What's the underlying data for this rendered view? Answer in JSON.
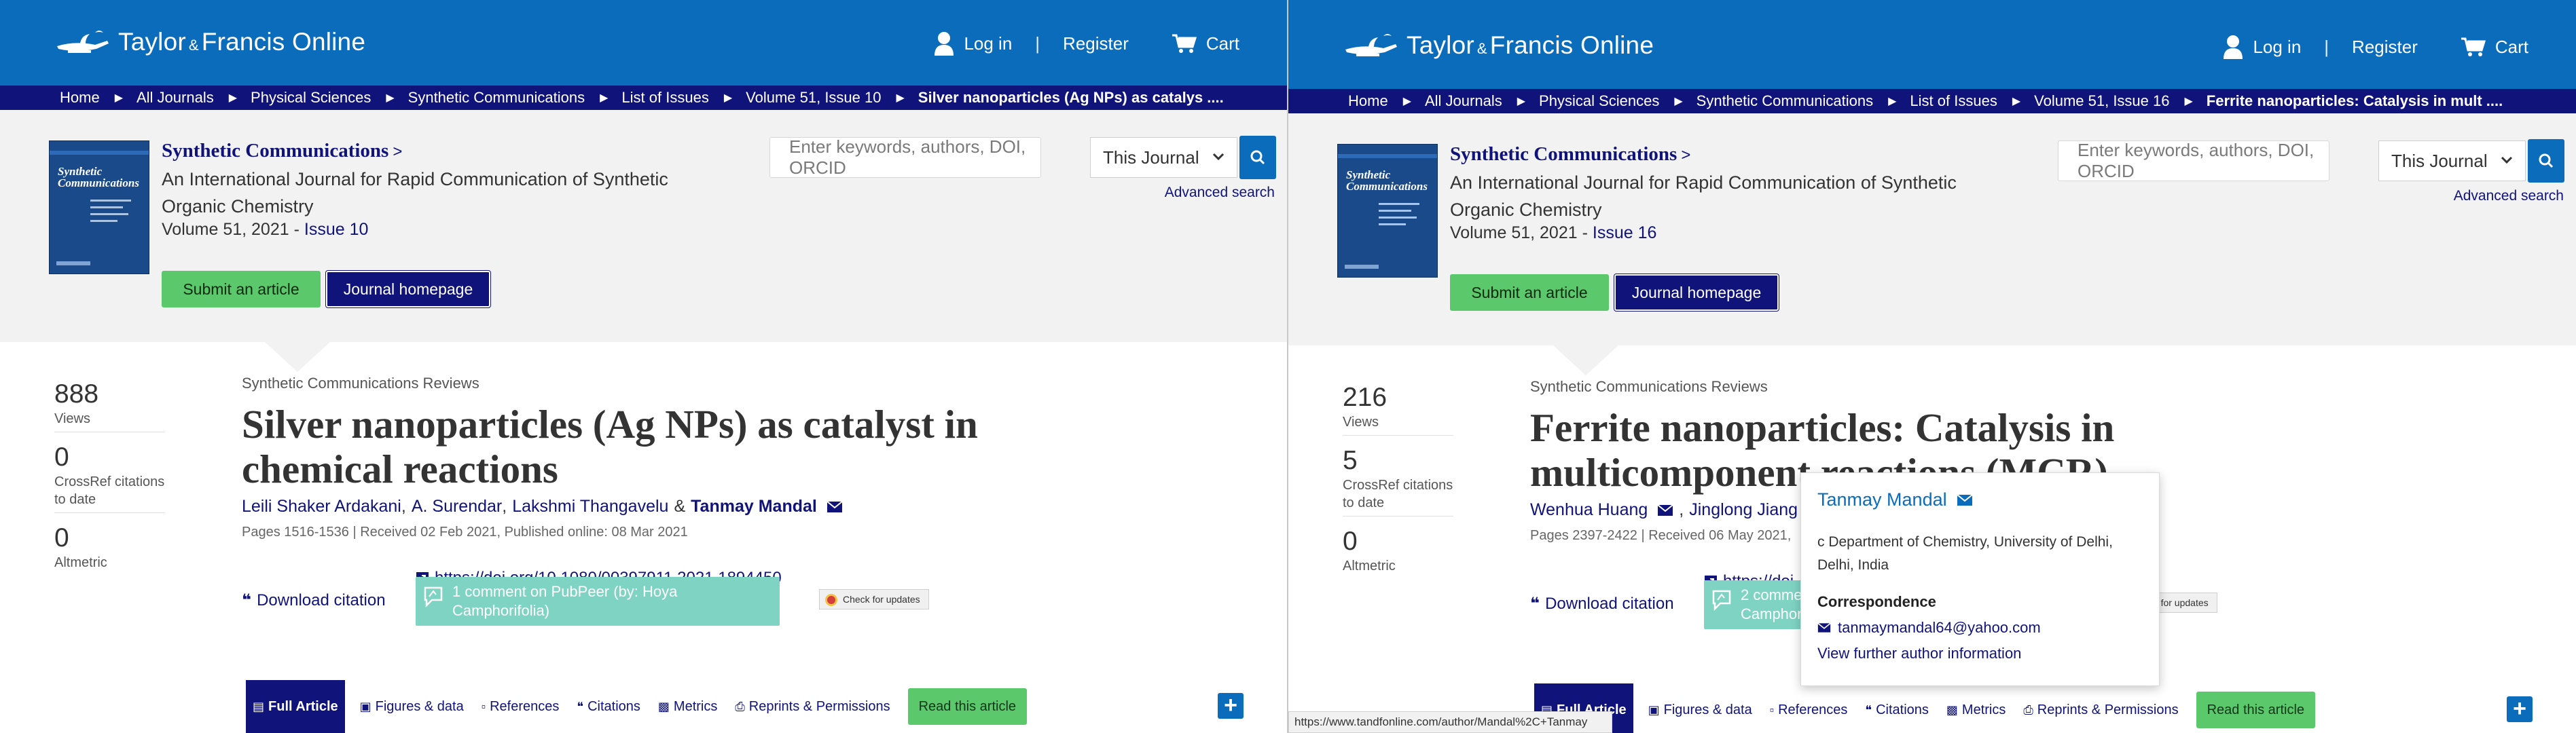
{
  "brand": {
    "name_a": "Taylor",
    "amp": "&",
    "name_b": "Francis Online"
  },
  "nav": {
    "login": "Log in",
    "register": "Register",
    "cart": "Cart",
    "separator": "|"
  },
  "search": {
    "placeholder": "Enter keywords, authors, DOI, ORCID",
    "scope": "This Journal",
    "advanced": "Advanced search"
  },
  "journal": {
    "title": "Synthetic Communications",
    "chevron": ">",
    "subtitle": "An International Journal for Rapid Communication of Synthetic Organic Chemistry",
    "submit": "Submit an article",
    "homepage": "Journal homepage"
  },
  "colors": {
    "brand_blue": "#0b6cbc",
    "navy": "#10137a",
    "green": "#5cc86c",
    "pubpeer": "#7fd3c3"
  },
  "left": {
    "breadcrumb": [
      "Home",
      "All Journals",
      "Physical Sciences",
      "Synthetic Communications",
      "List of Issues",
      "Volume 51, Issue 10",
      "Silver nanoparticles (Ag NPs) as catalys ...."
    ],
    "volume": "Volume 51, 2021 - ",
    "issue": "Issue 10",
    "metrics": [
      {
        "value": "888",
        "label": "Views"
      },
      {
        "value": "0",
        "label": "CrossRef citations to date"
      },
      {
        "value": "0",
        "label": "Altmetric"
      }
    ],
    "article_type": "Synthetic Communications Reviews",
    "title": "Silver nanoparticles (Ag NPs) as catalyst in chemical reactions",
    "authors": [
      "Leili Shaker Ardakani",
      "A. Surendar",
      "Lakshmi Thangavelu",
      "Tanmay Mandal"
    ],
    "author_sep": ",",
    "author_amp": "&",
    "pages": "Pages 1516-1536 | Received 02 Feb 2021, Published online: 08 Mar 2021",
    "doi": "https://doi.org/10.1080/00397911.2021.1894450",
    "download_citation": "Download citation",
    "pubpeer": "1 comment on PubPeer (by: Hoya Camphorifolia)",
    "check_updates": "Check for updates"
  },
  "right": {
    "breadcrumb": [
      "Home",
      "All Journals",
      "Physical Sciences",
      "Synthetic Communications",
      "List of Issues",
      "Volume 51, Issue 16",
      "Ferrite nanoparticles: Catalysis in mult ...."
    ],
    "volume": "Volume 51, 2021 - ",
    "issue": "Issue 16",
    "metrics": [
      {
        "value": "216",
        "label": "Views"
      },
      {
        "value": "5",
        "label": "CrossRef citations to date"
      },
      {
        "value": "0",
        "label": "Altmetric"
      }
    ],
    "article_type": "Synthetic Communications Reviews",
    "title": "Ferrite nanoparticles: Catalysis in multicomponent reactions (MCR)",
    "authors": [
      "Wenhua Huang",
      "Jinglong Jiang"
    ],
    "author_sep": ",",
    "pages": "Pages 2397-2422 | Received 06 May 2021,",
    "doi": "https://doi.",
    "download_citation": "Download citation",
    "pubpeer": "2 comments on PubPeer (by: Hoya Camphorifolia)",
    "check_updates": "Check for updates",
    "popup": {
      "name": "Tanmay Mandal",
      "affiliation": "c Department of Chemistry, University of Delhi, Delhi, India",
      "correspondence": "Correspondence",
      "email": "tanmaymandal64@yahoo.com",
      "more": "View further author information"
    },
    "status_url": "https://www.tandfonline.com/author/Mandal%2C+Tanmay"
  },
  "tabs": {
    "full_article": "Full Article",
    "figures": "Figures & data",
    "references": "References",
    "citations": "Citations",
    "metrics": "Metrics",
    "reprints": "Reprints & Permissions",
    "read": "Read this article"
  },
  "plus": "+"
}
